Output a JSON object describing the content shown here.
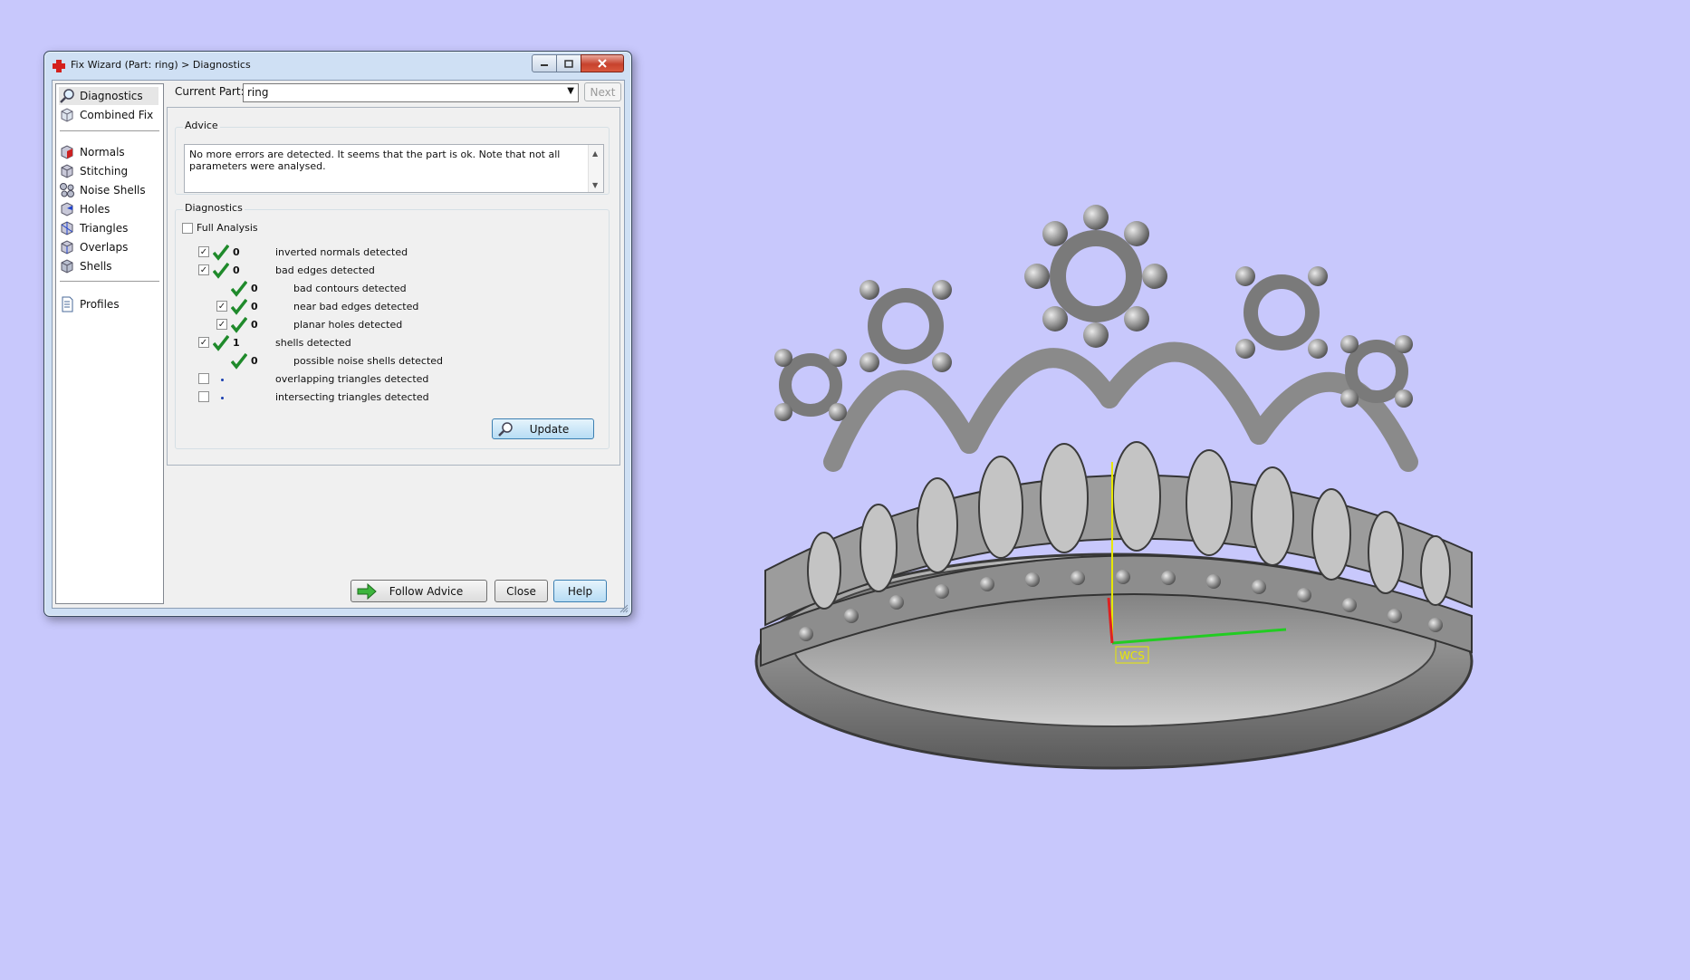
{
  "window": {
    "title": "Fix Wizard (Part: ring) > Diagnostics",
    "min_icon": "minimize-icon",
    "max_icon": "maximize-icon",
    "close_icon": "close-icon"
  },
  "nav": {
    "top_items": [
      {
        "label": "Diagnostics",
        "icon": "magnifier-icon"
      },
      {
        "label": "Combined Fix",
        "icon": "combined-fix-icon"
      }
    ],
    "fix_items": [
      {
        "label": "Normals",
        "icon": "normals-icon"
      },
      {
        "label": "Stitching",
        "icon": "stitching-icon"
      },
      {
        "label": "Noise Shells",
        "icon": "noise-shells-icon"
      },
      {
        "label": "Holes",
        "icon": "holes-icon"
      },
      {
        "label": "Triangles",
        "icon": "triangles-icon"
      },
      {
        "label": "Overlaps",
        "icon": "overlaps-icon"
      },
      {
        "label": "Shells",
        "icon": "shells-icon"
      }
    ],
    "bottom_items": [
      {
        "label": "Profiles",
        "icon": "document-icon"
      }
    ]
  },
  "part": {
    "label": "Current Part:",
    "value": "ring",
    "next_label": "Next"
  },
  "advice": {
    "title": "Advice",
    "text": "No more errors are detected. It seems that the part is ok. Note that not all parameters were analysed."
  },
  "diagnostics": {
    "title": "Diagnostics",
    "full_analysis_label": "Full Analysis",
    "full_analysis_checked": false,
    "rows": [
      {
        "checkbox": true,
        "checked": true,
        "status": "ok",
        "count": "0",
        "label": "inverted normals detected",
        "indent": 0
      },
      {
        "checkbox": true,
        "checked": true,
        "status": "ok",
        "count": "0",
        "label": "bad edges detected",
        "indent": 0
      },
      {
        "checkbox": false,
        "checked": false,
        "status": "ok",
        "count": "0",
        "label": "bad contours detected",
        "indent": 1
      },
      {
        "checkbox": true,
        "checked": true,
        "status": "ok",
        "count": "0",
        "label": "near bad edges detected",
        "indent": 1
      },
      {
        "checkbox": true,
        "checked": true,
        "status": "ok",
        "count": "0",
        "label": "planar holes detected",
        "indent": 1
      },
      {
        "checkbox": true,
        "checked": true,
        "status": "ok",
        "count": "1",
        "label": "shells detected",
        "indent": 0
      },
      {
        "checkbox": false,
        "checked": false,
        "status": "ok",
        "count": "0",
        "label": "possible noise shells detected",
        "indent": 1
      },
      {
        "checkbox": true,
        "checked": false,
        "status": "pending",
        "count": "",
        "label": "overlapping triangles detected",
        "indent": 0
      },
      {
        "checkbox": true,
        "checked": false,
        "status": "pending",
        "count": "",
        "label": "intersecting triangles detected",
        "indent": 0
      }
    ],
    "update_label": "Update"
  },
  "footer": {
    "follow_advice_label": "Follow Advice",
    "close_label": "Close",
    "help_label": "Help"
  },
  "viewport": {
    "axis_label": "WCS",
    "background": "#c8c8fc",
    "x_axis_color": "#22cc22",
    "y_axis_color": "#e8e800",
    "z_axis_color": "#dd2222"
  }
}
